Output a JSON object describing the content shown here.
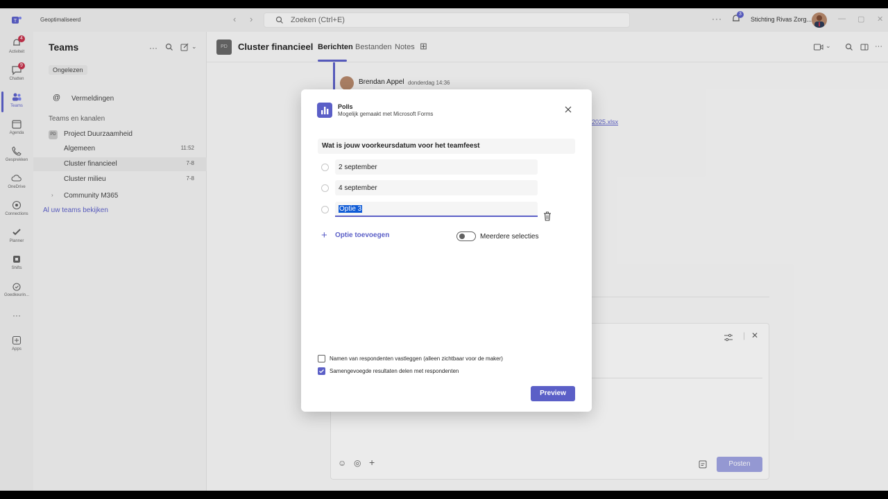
{
  "titlebar": {
    "profile": "Geoptimaliseerd",
    "search_placeholder": "Zoeken (Ctrl+E)",
    "notif_count": "3",
    "org": "Stichting Rivas Zorg..."
  },
  "rail": {
    "items": [
      {
        "label": "Activiteit",
        "badge": "4",
        "icon": "bell-icon"
      },
      {
        "label": "Chatten",
        "badge": "9",
        "icon": "chat-icon"
      },
      {
        "label": "Teams",
        "badge": "",
        "icon": "teams-icon"
      },
      {
        "label": "Agenda",
        "badge": "",
        "icon": "calendar-icon"
      },
      {
        "label": "Gesprekken",
        "badge": "",
        "icon": "phone-icon"
      },
      {
        "label": "OneDrive",
        "badge": "",
        "icon": "cloud-icon"
      },
      {
        "label": "Connections",
        "badge": "",
        "icon": "connections-icon"
      },
      {
        "label": "Planner",
        "badge": "",
        "icon": "planner-icon"
      },
      {
        "label": "Shifts",
        "badge": "",
        "icon": "shifts-icon"
      },
      {
        "label": "Goedkeurin...",
        "badge": "",
        "icon": "approvals-icon"
      },
      {
        "label": "Apps",
        "badge": "",
        "icon": "apps-icon"
      }
    ]
  },
  "panel": {
    "title": "Teams",
    "chip": "Ongelezen",
    "mentions": "Vermeldingen",
    "section": "Teams en kanalen",
    "team1": "Project Duurzaamheid",
    "channels": [
      {
        "label": "Algemeen",
        "meta": "11:52"
      },
      {
        "label": "Cluster financieel",
        "meta": "7-8"
      },
      {
        "label": "Cluster milieu",
        "meta": "7-8"
      }
    ],
    "team2": "Community M365",
    "see_all": "Al uw teams bekijken"
  },
  "channel": {
    "avatar": "PD",
    "name": "Cluster financieel",
    "tabs": [
      "Berichten",
      "Bestanden",
      "Notes"
    ]
  },
  "message": {
    "author": "Brendan Appel",
    "time": "donderdag 14:36",
    "link": "2025.xlsx"
  },
  "compose": {
    "post": "Posten"
  },
  "dialog": {
    "title": "Polls",
    "subtitle": "Mogelijk gemaakt met Microsoft Forms",
    "question": "Wat is jouw voorkeursdatum voor het teamfeest",
    "options": [
      "2 september",
      "4 september",
      "Optie 3"
    ],
    "add_option": "Optie toevoegen",
    "multi_select": "Meerdere selecties",
    "multi_select_on": false,
    "chk_record_names": "Namen van respondenten vastleggen (alleen zichtbaar voor de maker)",
    "chk_record_names_checked": false,
    "chk_share_results": "Samengevoegde resultaten delen met respondenten",
    "chk_share_results_checked": true,
    "preview": "Preview"
  },
  "colors": {
    "accent": "#5b5fc7",
    "selection": "#0f5bd6",
    "badge": "#c4314b"
  }
}
